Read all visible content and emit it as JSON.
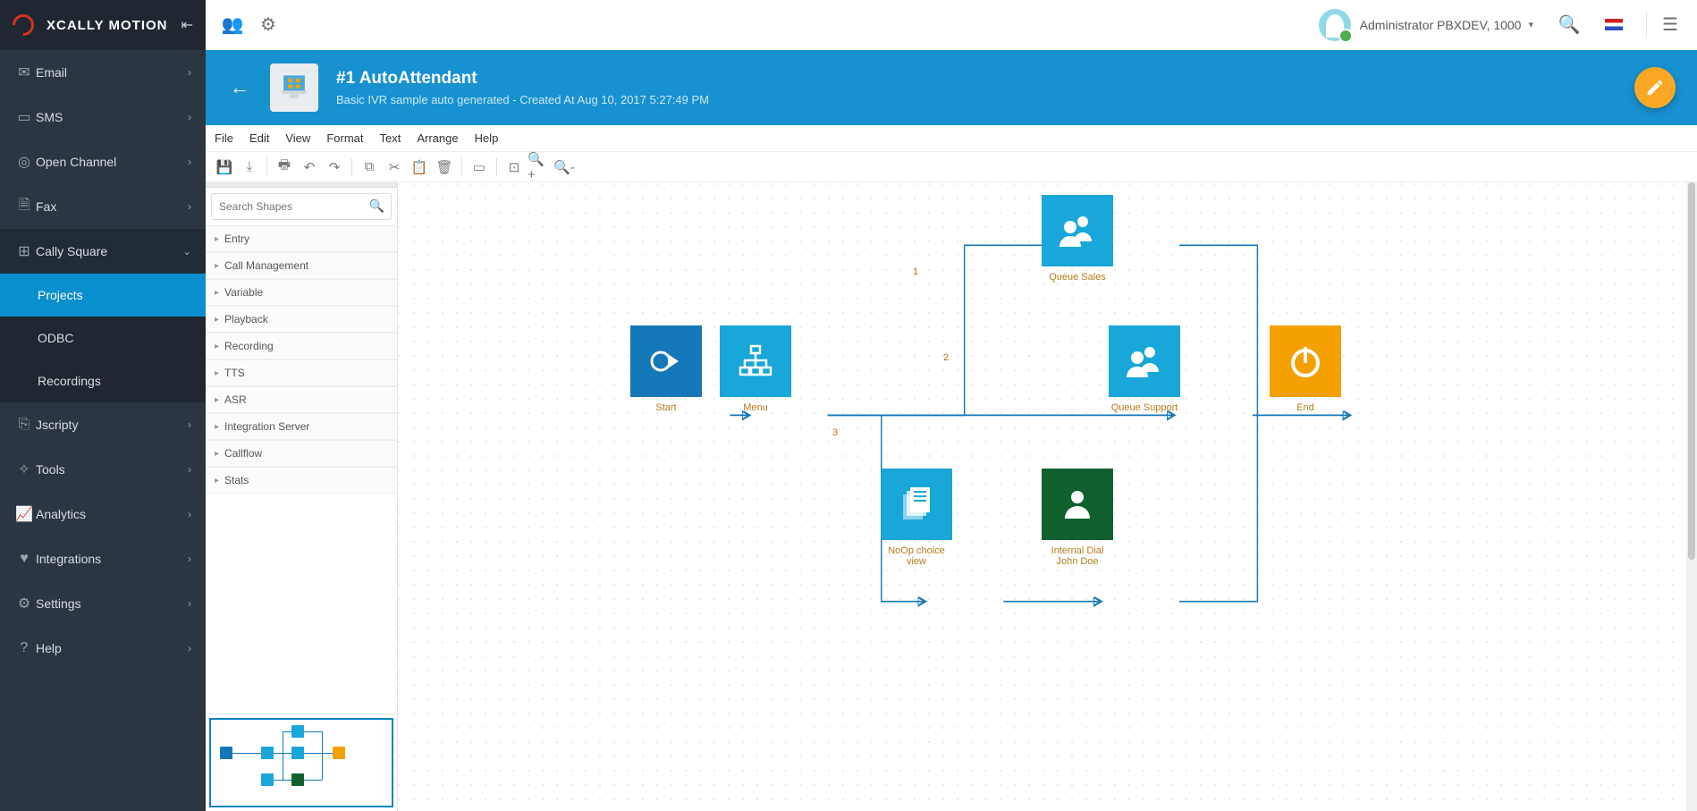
{
  "brand": "XCALLY MOTION",
  "user_name": "Administrator PBXDEV, 1000",
  "sidebar": {
    "items": [
      {
        "icon": "✉",
        "label": "Email",
        "expand": true
      },
      {
        "icon": "▭",
        "label": "SMS",
        "expand": true
      },
      {
        "icon": "◎",
        "label": "Open Channel",
        "expand": true
      },
      {
        "icon": "🗎",
        "label": "Fax",
        "expand": true
      },
      {
        "icon": "⊞",
        "label": "Cally Square",
        "expand_open": true,
        "children": [
          {
            "label": "Projects",
            "active": true
          },
          {
            "label": "ODBC"
          },
          {
            "label": "Recordings"
          }
        ]
      },
      {
        "icon": "⎘",
        "label": "Jscripty",
        "expand": true
      },
      {
        "icon": "✧",
        "label": "Tools",
        "expand": true
      },
      {
        "icon": "✓",
        "label": "Analytics",
        "expand": true
      },
      {
        "icon": "♥",
        "label": "Integrations",
        "expand": true
      },
      {
        "icon": "⚙",
        "label": "Settings",
        "expand": true
      },
      {
        "icon": "?",
        "label": "Help",
        "expand": true
      }
    ]
  },
  "banner": {
    "title": "#1 AutoAttendant",
    "subtitle": "Basic IVR sample auto generated - Created At Aug 10, 2017 5:27:49 PM"
  },
  "menubar": [
    "File",
    "Edit",
    "View",
    "Format",
    "Text",
    "Arrange",
    "Help"
  ],
  "search_placeholder": "Search Shapes",
  "palette_categories": [
    "Entry",
    "Call Management",
    "Variable",
    "Playback",
    "Recording",
    "TTS",
    "ASR",
    "Integration Server",
    "Callflow",
    "Stats"
  ],
  "nodes": {
    "start": {
      "label": "Start"
    },
    "menu": {
      "label": "Menu"
    },
    "qsales": {
      "label": "Queue Sales"
    },
    "qsupport": {
      "label": "Queue Support"
    },
    "noop": {
      "label": "NoOp choice view"
    },
    "idial": {
      "label": "Internal Dial John Doe"
    },
    "end": {
      "label": "End"
    }
  },
  "edge_labels": {
    "e1": "1",
    "e2": "2",
    "e3": "3"
  }
}
